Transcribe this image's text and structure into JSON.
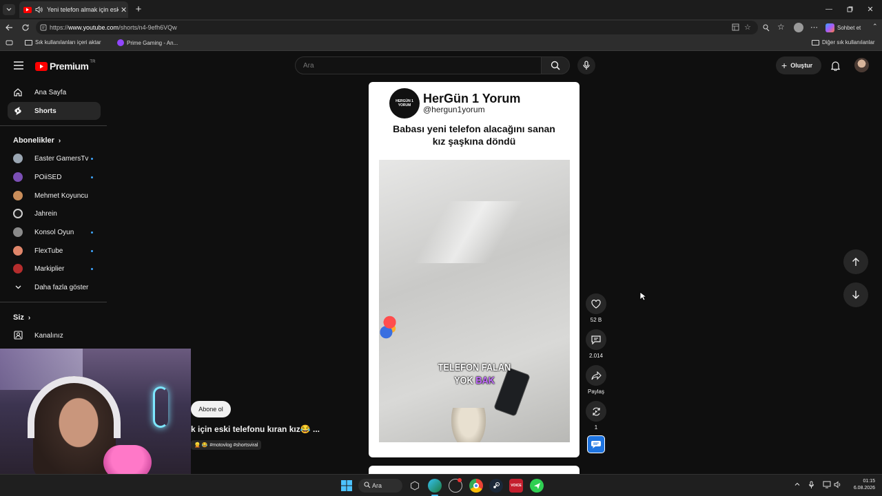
{
  "browser": {
    "tab_title": "Yeni telefon almak için eski te",
    "url_prefix": "https://",
    "url_host": "www.youtube.com",
    "url_path": "/shorts/n4-9efh6VQw",
    "copilot_label": "Sohbet et",
    "bookmarks": [
      "Sık kullanılanları içeri aktar",
      "Prime Gaming - An..."
    ],
    "other_bookmarks": "Diğer sık kullanılanlar"
  },
  "youtube": {
    "logo_text": "Premium",
    "logo_region": "TR",
    "search_placeholder": "Ara",
    "create_label": "Oluştur",
    "sidebar": {
      "home": "Ana Sayfa",
      "shorts": "Shorts",
      "subscriptions_header": "Abonelikler",
      "subscriptions": [
        {
          "name": "Easter GamersTv",
          "new": true,
          "color": "#9aa6b2"
        },
        {
          "name": "POiiSED",
          "new": true,
          "color": "#7b4fb5"
        },
        {
          "name": "Mehmet Koyuncu",
          "new": false,
          "color": "#c98d5a"
        },
        {
          "name": "Jahrein",
          "new": false,
          "color": "#d0d0d0"
        },
        {
          "name": "Konsol Oyun",
          "new": true,
          "color": "#8a8a8a"
        },
        {
          "name": "FlexTube",
          "new": true,
          "color": "#e0866a"
        },
        {
          "name": "Markiplier",
          "new": true,
          "color": "#b52d2d"
        }
      ],
      "show_more": "Daha fazla göster",
      "you_header": "Siz",
      "your_channel": "Kanalınız"
    },
    "short": {
      "channel_name": "HerGün 1 Yorum",
      "channel_handle": "@hergun1yorum",
      "logo_text": "HERGÜN 1 YORUM",
      "headline_line1": "Babası yeni telefon alacağını sanan",
      "headline_line2": "kız şaşkına döndü",
      "caption_line1": "TELEFON FALAN",
      "caption_line2_a": "YOK",
      "caption_line2_b": "BAK",
      "subscribe_label": "Abone ol",
      "title": "k için eski telefonu kıran kız😂 ...",
      "hashtags": "#motovlog #shortsviral",
      "likes": "52 B",
      "comments": "2.014",
      "share_label": "Paylaş",
      "remix_count": "1"
    }
  },
  "taskbar": {
    "search_label": "Ara",
    "time": "01:15",
    "date": "6.08.2026"
  }
}
